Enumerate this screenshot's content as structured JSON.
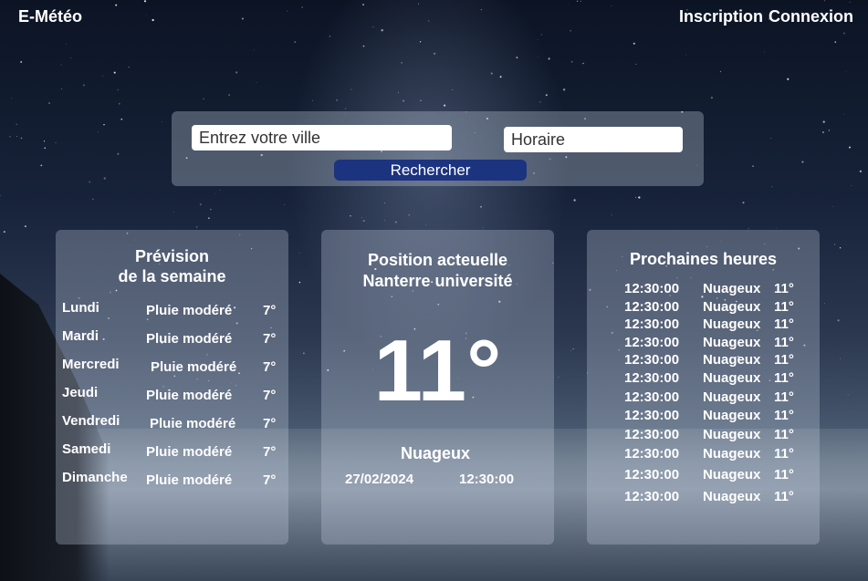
{
  "header": {
    "brand": "E-Météo",
    "signup_label": "Inscription",
    "login_label": "Connexion"
  },
  "search": {
    "city_placeholder": "Entrez votre ville",
    "time_placeholder": "Horaire",
    "button_label": "Rechercher"
  },
  "week": {
    "title_line1": "Prévision",
    "title_line2": "de la semaine",
    "days": [
      {
        "day": "Lundi",
        "condition": "Pluie modéré",
        "temp": "7°"
      },
      {
        "day": "Mardi",
        "condition": "Pluie modéré",
        "temp": "7°"
      },
      {
        "day": "Mercredi",
        "condition": "Pluie modéré",
        "temp": "7°"
      },
      {
        "day": "Jeudi",
        "condition": "Pluie modéré",
        "temp": "7°"
      },
      {
        "day": "Vendredi",
        "condition": "Pluie modéré",
        "temp": "7°"
      },
      {
        "day": "Samedi",
        "condition": "Pluie modéré",
        "temp": "7°"
      },
      {
        "day": "Dimanche",
        "condition": "Pluie modéré",
        "temp": "7°"
      }
    ]
  },
  "current": {
    "title_line1": "Position acteuelle",
    "title_line2": "Nanterre université",
    "temperature": "11°",
    "condition": "Nuageux",
    "date": "27/02/2024",
    "time": "12:30:00"
  },
  "hours": {
    "title": "Prochaines heures",
    "rows": [
      {
        "time": "12:30:00",
        "condition": "Nuageux",
        "temp": "11°"
      },
      {
        "time": "12:30:00",
        "condition": "Nuageux",
        "temp": "11°"
      },
      {
        "time": "12:30:00",
        "condition": "Nuageux",
        "temp": "11°"
      },
      {
        "time": "12:30:00",
        "condition": "Nuageux",
        "temp": "11°"
      },
      {
        "time": "12:30:00",
        "condition": "Nuageux",
        "temp": "11°"
      },
      {
        "time": "12:30:00",
        "condition": "Nuageux",
        "temp": "11°"
      },
      {
        "time": "12:30:00",
        "condition": "Nuageux",
        "temp": "11°"
      },
      {
        "time": "12:30:00",
        "condition": "Nuageux",
        "temp": "11°"
      },
      {
        "time": "12:30:00",
        "condition": "Nuageux",
        "temp": "11°"
      },
      {
        "time": "12:30:00",
        "condition": "Nuageux",
        "temp": "11°"
      },
      {
        "time": "12:30:00",
        "condition": "Nuageux",
        "temp": "11°"
      },
      {
        "time": "12:30:00",
        "condition": "Nuageux",
        "temp": "11°"
      }
    ]
  },
  "colors": {
    "button_bg": "#1c3380",
    "panel_bg": "rgba(200,210,225,0.30)",
    "text": "#ffffff"
  }
}
